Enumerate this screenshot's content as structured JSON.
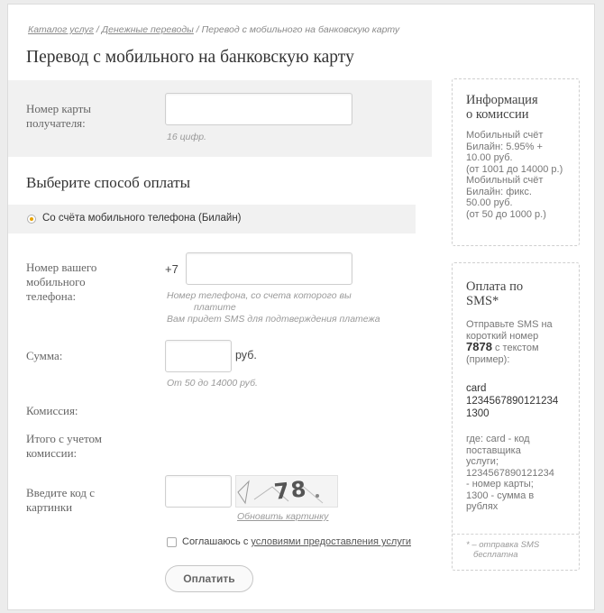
{
  "breadcrumb": {
    "items": [
      "Каталог услуг",
      "Денежные переводы",
      "Перевод с мобильного на банковскую карту"
    ],
    "separator": "/"
  },
  "page_title": "Перевод с мобильного на банковскую карту",
  "card_section": {
    "label_line1": "Номер карты",
    "label_line2": "получателя:",
    "value": "",
    "hint": "16 цифр."
  },
  "payment_method": {
    "heading": "Выберите способ оплаты",
    "option_label": "Со счёта мобильного телефона (Билайн)"
  },
  "phone": {
    "label_line1": "Номер вашего",
    "label_line2": "мобильного",
    "label_line3": "телефона:",
    "prefix": "+7",
    "value": "",
    "hint_line1": "Номер телефона, со счета которого вы",
    "hint_line2": "платите",
    "hint_line3": "Вам придет SMS для подтверждения платежа"
  },
  "amount": {
    "label": "Сумма:",
    "value": "",
    "unit": "руб.",
    "hint": "От 50 до 14000 руб."
  },
  "commission": {
    "label": "Комиссия:"
  },
  "total": {
    "label_line1": "Итого с учетом",
    "label_line2": "комиссии:"
  },
  "captcha": {
    "label_line1": "Введите код с",
    "label_line2": "картинки",
    "value": "",
    "image_text": "78",
    "refresh_link": "Обновить картинку"
  },
  "agree": {
    "prefix": "Соглашаюсь с",
    "link": "условиями предоставления услуги"
  },
  "submit_label": "Оплатить",
  "info_commission": {
    "title_line1": "Информация",
    "title_line2": "о комиссии",
    "lines": [
      "Мобильный счёт",
      "Билайн:  5.95% +",
      "10.00 руб.",
      "(от 1001 до 14000 р.)",
      "Мобильный счёт",
      "Билайн:  фикс.",
      "50.00 руб.",
      "(от 50 до 1000 р.)"
    ]
  },
  "sms_pay": {
    "title_line1": "Оплата по",
    "title_line2": "SMS*",
    "intro_lines": [
      "Отправьте SMS на",
      "короткий номер"
    ],
    "short_number": "7878",
    "intro_after": "с текстом",
    "intro_example": "(пример):",
    "example_lines": [
      "card",
      "1234567890121234",
      "1300"
    ],
    "explain_lines": [
      "где: card - код",
      "поставщика",
      "услуги;",
      "1234567890121234",
      "- номер карты;",
      "1300 - сумма в",
      "рублях"
    ],
    "footnote_line1": "* – отправка SMS",
    "footnote_line2": "бесплатна"
  },
  "colors": {
    "accent": "#e8a200",
    "grey_band": "#f1f1f1"
  }
}
